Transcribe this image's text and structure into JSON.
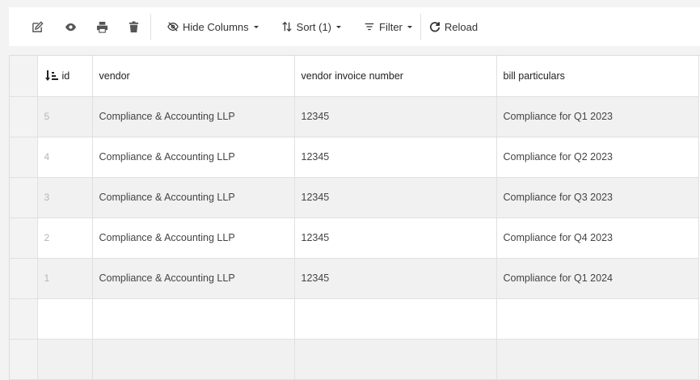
{
  "toolbar": {
    "icons": [
      "edit-icon",
      "eye-icon",
      "print-icon",
      "trash-icon"
    ],
    "hide_columns_label": "Hide Columns",
    "sort_label": "Sort (1)",
    "filter_label": "Filter",
    "reload_label": "Reload"
  },
  "table": {
    "columns": [
      "id",
      "vendor",
      "vendor invoice number",
      "bill particulars"
    ],
    "rows": [
      {
        "id": "5",
        "vendor": "Compliance & Accounting LLP",
        "invoice": "12345",
        "particulars": "Compliance for Q1 2023"
      },
      {
        "id": "4",
        "vendor": "Compliance & Accounting LLP",
        "invoice": "12345",
        "particulars": "Compliance for Q2 2023"
      },
      {
        "id": "3",
        "vendor": "Compliance & Accounting LLP",
        "invoice": "12345",
        "particulars": "Compliance for Q3 2023"
      },
      {
        "id": "2",
        "vendor": "Compliance & Accounting LLP",
        "invoice": "12345",
        "particulars": "Compliance for Q4 2023"
      },
      {
        "id": "1",
        "vendor": "Compliance & Accounting LLP",
        "invoice": "12345",
        "particulars": "Compliance for Q1 2024"
      }
    ],
    "sort_column": "id",
    "sort_direction": "descending"
  }
}
